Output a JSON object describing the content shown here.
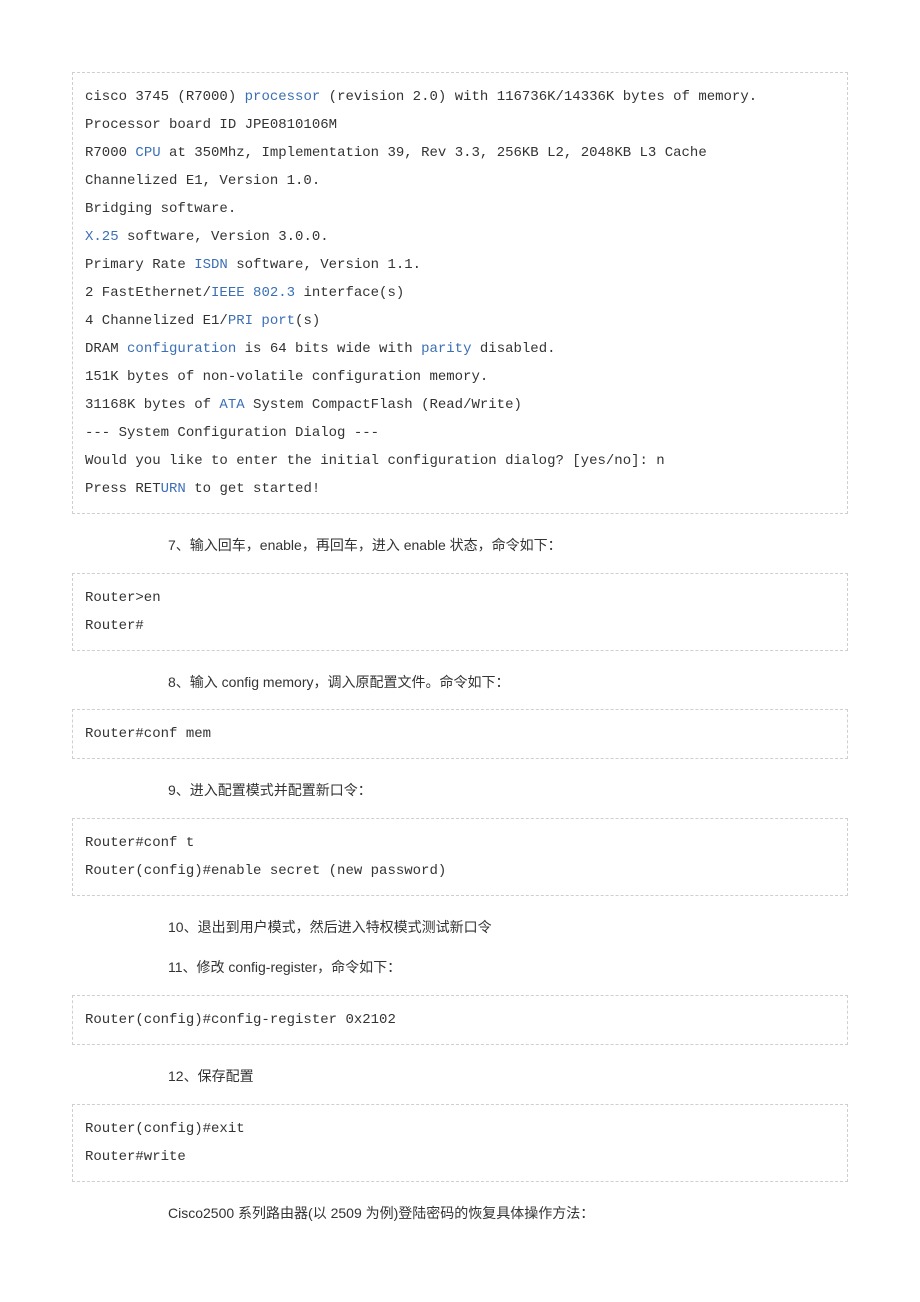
{
  "code1": {
    "t01a": "cisco 3745 (R7000) ",
    "t01b": "processor",
    "t01c": " (revision 2.0) with 116736K/14336K bytes of memory.",
    "t02": "Processor board ID JPE0810106M",
    "t03a": "R7000 ",
    "t03b": "CPU",
    "t03c": " at 350Mhz, Implementation 39, Rev 3.3, 256KB L2, 2048KB L3 Cache",
    "t04": "Channelized E1, Version 1.0.",
    "t05": "Bridging software.",
    "t06a": "X.25",
    "t06b": " software, Version 3.0.0.",
    "t07a": "Primary Rate ",
    "t07b": "ISDN",
    "t07c": " software, Version 1.1.",
    "t08a": "2 FastEthernet/",
    "t08b": "IEEE 802.3",
    "t08c": " interface(s)",
    "t09a": "4 Channelized E1/",
    "t09b": "PRI port",
    "t09c": "(s)",
    "t10a": "DRAM ",
    "t10b": "configuration",
    "t10c": " is 64 bits wide with ",
    "t10d": "parity",
    "t10e": " disabled.",
    "t11": "151K bytes of non-volatile configuration memory.",
    "t12a": "31168K bytes of ",
    "t12b": "ATA",
    "t12c": " System CompactFlash (Read/Write)",
    "t13": "--- System Configuration Dialog ---",
    "t14": "Would you like to enter the initial configuration dialog? [yes/no]: n",
    "t15a": "Press RET",
    "t15b": "URN",
    "t15c": " to get started!"
  },
  "step7": "7、输入回车，enable，再回车，进入 enable 状态，命令如下：",
  "code2": {
    "l1": "Router>en",
    "l2": "Router#"
  },
  "step8": "8、输入 config memory，调入原配置文件。命令如下：",
  "code3": "Router#conf mem",
  "step9": "9、进入配置模式并配置新口令：",
  "code4": {
    "l1": "Router#conf t",
    "l2": "Router(config)#enable secret (new password)"
  },
  "step10": "10、退出到用户模式，然后进入特权模式测试新口令",
  "step11": "11、修改 config-register，命令如下：",
  "code5": "Router(config)#config-register 0x2102",
  "step12": "12、保存配置",
  "code6": {
    "l1": "Router(config)#exit",
    "l2": "Router#write"
  },
  "footer": "Cisco2500 系列路由器(以 2509 为例)登陆密码的恢复具体操作方法："
}
